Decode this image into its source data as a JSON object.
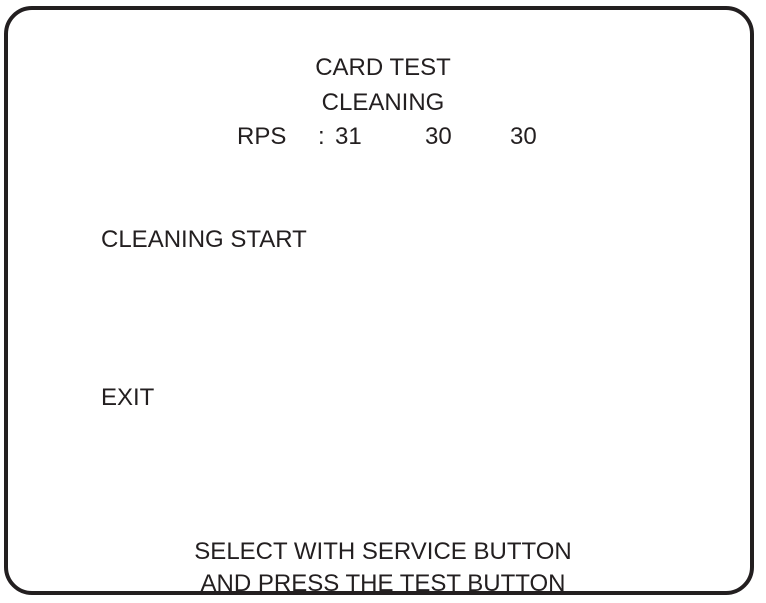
{
  "header": {
    "title": "CARD TEST",
    "subtitle": "CLEANING"
  },
  "rps": {
    "label": "RPS",
    "separator": ":",
    "values": [
      "31",
      "30",
      "30"
    ]
  },
  "menu": {
    "items": [
      {
        "label": "CLEANING START"
      },
      {
        "label": "EXIT"
      }
    ]
  },
  "footer": {
    "line1": "SELECT WITH SERVICE BUTTON",
    "line2": "AND PRESS THE TEST BUTTON"
  },
  "colors": {
    "text": "#231f20",
    "background": "#ffffff",
    "frame": "#231f20"
  }
}
